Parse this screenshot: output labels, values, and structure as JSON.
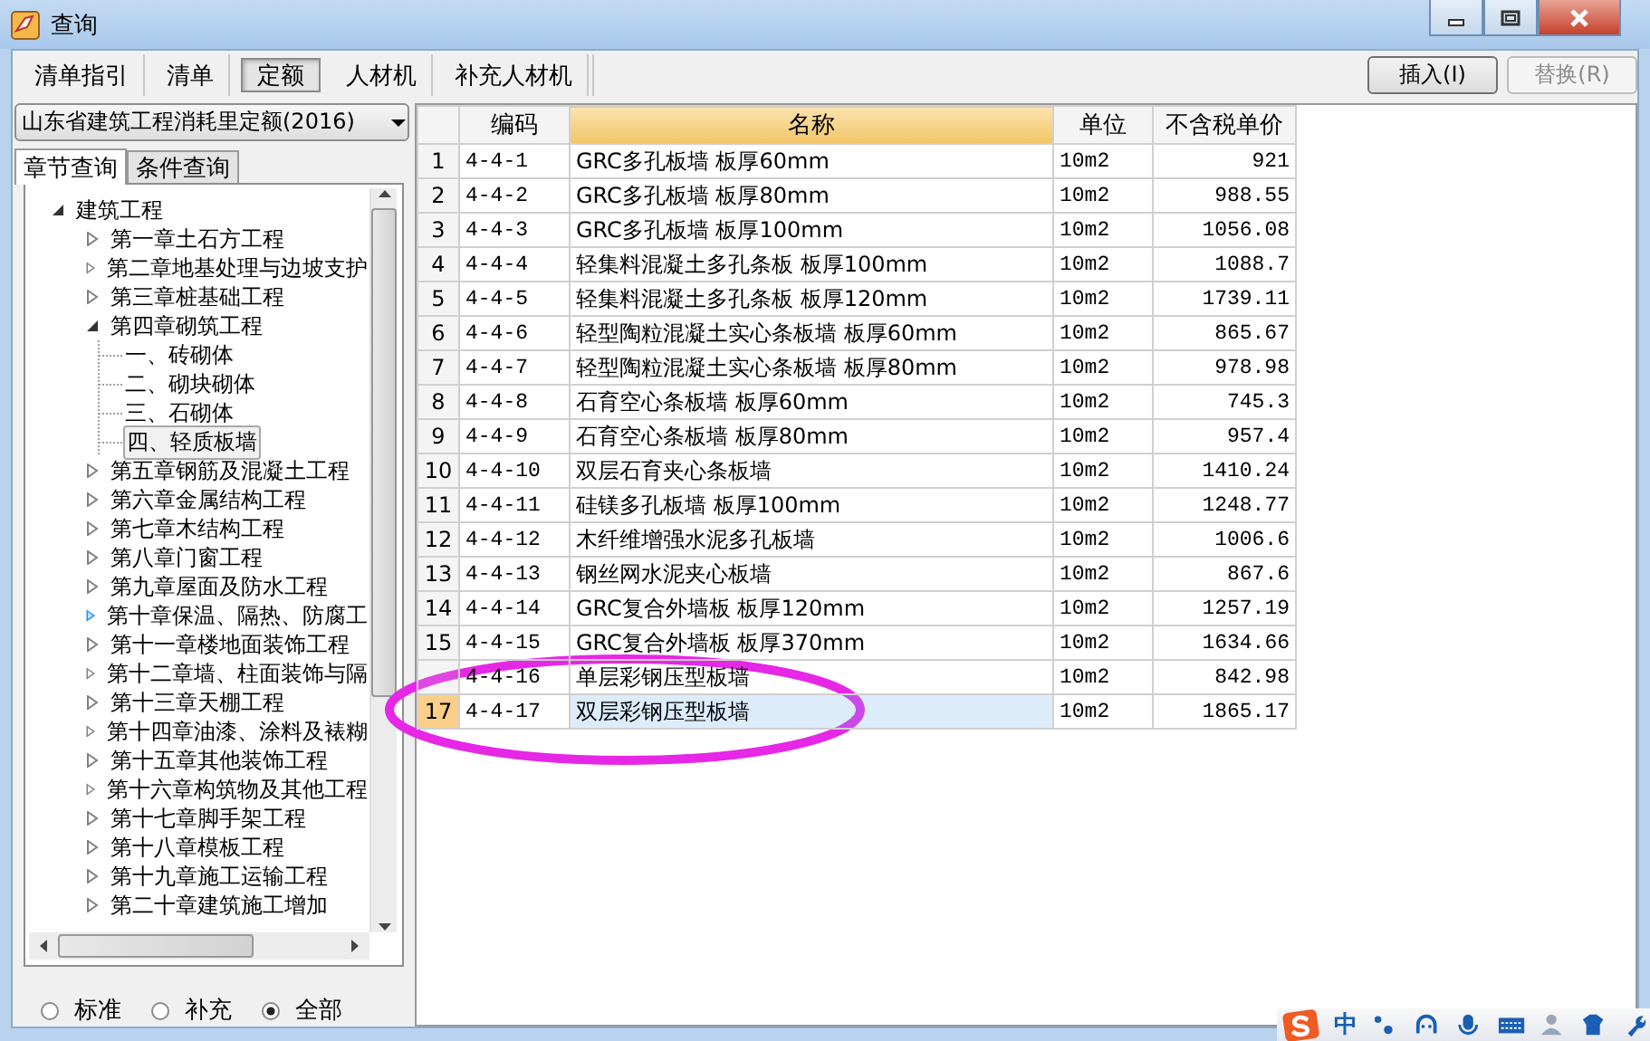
{
  "window": {
    "title": "查询"
  },
  "toolbar": {
    "tabs": [
      {
        "label": "清单指引",
        "selected": false
      },
      {
        "label": "清单",
        "selected": false
      },
      {
        "label": "定额",
        "selected": true
      },
      {
        "label": "人材机",
        "selected": false
      },
      {
        "label": "补充人材机",
        "selected": false
      }
    ],
    "buttons": [
      {
        "label": "插入(I)",
        "disabled": false
      },
      {
        "label": "替换(R)",
        "disabled": true
      }
    ]
  },
  "sidebar": {
    "dropdown": {
      "value": "山东省建筑工程消耗里定额(2016)"
    },
    "tabs": [
      {
        "label": "章节查询",
        "selected": true
      },
      {
        "label": "条件查询",
        "selected": false
      }
    ],
    "tree": [
      {
        "label": "建筑工程",
        "expanded": true,
        "selected": false,
        "children": [
          {
            "label": "第一章土石方工程",
            "expanded": false,
            "selected": false
          },
          {
            "label": "第二章地基处理与边坡支护",
            "expanded": false,
            "selected": false
          },
          {
            "label": "第三章桩基础工程",
            "expanded": false,
            "selected": false
          },
          {
            "label": "第四章砌筑工程",
            "expanded": true,
            "selected": false,
            "children": [
              {
                "label": "一、砖砌体",
                "selected": false
              },
              {
                "label": "二、砌块砌体",
                "selected": false
              },
              {
                "label": "三、石砌体",
                "selected": false
              },
              {
                "label": "四、轻质板墙",
                "selected": true
              }
            ]
          },
          {
            "label": "第五章钢筋及混凝土工程",
            "expanded": false,
            "selected": false
          },
          {
            "label": "第六章金属结构工程",
            "expanded": false,
            "selected": false
          },
          {
            "label": "第七章木结构工程",
            "expanded": false,
            "selected": false
          },
          {
            "label": "第八章门窗工程",
            "expanded": false,
            "selected": false
          },
          {
            "label": "第九章屋面及防水工程",
            "expanded": false,
            "selected": false
          },
          {
            "label": "第十章保温、隔热、防腐工",
            "expanded": false,
            "selected": false,
            "hot": true
          },
          {
            "label": "第十一章楼地面装饰工程",
            "expanded": false,
            "selected": false
          },
          {
            "label": "第十二章墙、柱面装饰与隔",
            "expanded": false,
            "selected": false
          },
          {
            "label": "第十三章天棚工程",
            "expanded": false,
            "selected": false
          },
          {
            "label": "第十四章油漆、涂料及裱糊",
            "expanded": false,
            "selected": false
          },
          {
            "label": "第十五章其他装饰工程",
            "expanded": false,
            "selected": false
          },
          {
            "label": "第十六章构筑物及其他工程",
            "expanded": false,
            "selected": false
          },
          {
            "label": "第十七章脚手架工程",
            "expanded": false,
            "selected": false
          },
          {
            "label": "第十八章模板工程",
            "expanded": false,
            "selected": false
          },
          {
            "label": "第十九章施工运输工程",
            "expanded": false,
            "selected": false
          },
          {
            "label": "第二十章建筑施工增加",
            "expanded": false,
            "selected": false
          }
        ]
      }
    ],
    "radios": [
      {
        "label": "标准",
        "selected": false
      },
      {
        "label": "补充",
        "selected": false
      },
      {
        "label": "全部",
        "selected": true
      }
    ]
  },
  "table": {
    "columns": [
      {
        "label": "编码",
        "sorted": false
      },
      {
        "label": "名称",
        "sorted": true
      },
      {
        "label": "单位",
        "sorted": false
      },
      {
        "label": "不含税单价",
        "sorted": false
      }
    ],
    "rows": [
      {
        "num": "1",
        "code": "4-4-1",
        "name": "GRC多孔板墙 板厚60mm",
        "unit": "10m2",
        "price": "921",
        "selected": false
      },
      {
        "num": "2",
        "code": "4-4-2",
        "name": "GRC多孔板墙 板厚80mm",
        "unit": "10m2",
        "price": "988.55",
        "selected": false
      },
      {
        "num": "3",
        "code": "4-4-3",
        "name": "GRC多孔板墙 板厚100mm",
        "unit": "10m2",
        "price": "1056.08",
        "selected": false
      },
      {
        "num": "4",
        "code": "4-4-4",
        "name": "轻集料混凝土多孔条板 板厚100mm",
        "unit": "10m2",
        "price": "1088.7",
        "selected": false
      },
      {
        "num": "5",
        "code": "4-4-5",
        "name": "轻集料混凝土多孔条板 板厚120mm",
        "unit": "10m2",
        "price": "1739.11",
        "selected": false
      },
      {
        "num": "6",
        "code": "4-4-6",
        "name": "轻型陶粒混凝土实心条板墙 板厚60mm",
        "unit": "10m2",
        "price": "865.67",
        "selected": false
      },
      {
        "num": "7",
        "code": "4-4-7",
        "name": "轻型陶粒混凝土实心条板墙 板厚80mm",
        "unit": "10m2",
        "price": "978.98",
        "selected": false
      },
      {
        "num": "8",
        "code": "4-4-8",
        "name": "石育空心条板墙 板厚60mm",
        "unit": "10m2",
        "price": "745.3",
        "selected": false
      },
      {
        "num": "9",
        "code": "4-4-9",
        "name": "石育空心条板墙 板厚80mm",
        "unit": "10m2",
        "price": "957.4",
        "selected": false
      },
      {
        "num": "10",
        "code": "4-4-10",
        "name": "双层石育夹心条板墙",
        "unit": "10m2",
        "price": "1410.24",
        "selected": false
      },
      {
        "num": "11",
        "code": "4-4-11",
        "name": "硅镁多孔板墙 板厚100mm",
        "unit": "10m2",
        "price": "1248.77",
        "selected": false
      },
      {
        "num": "12",
        "code": "4-4-12",
        "name": "木纤维增强水泥多孔板墙",
        "unit": "10m2",
        "price": "1006.6",
        "selected": false
      },
      {
        "num": "13",
        "code": "4-4-13",
        "name": "钢丝网水泥夹心板墙",
        "unit": "10m2",
        "price": "867.6",
        "selected": false
      },
      {
        "num": "14",
        "code": "4-4-14",
        "name": "GRC复合外墙板 板厚120mm",
        "unit": "10m2",
        "price": "1257.19",
        "selected": false
      },
      {
        "num": "15",
        "code": "4-4-15",
        "name": "GRC复合外墙板 板厚370mm",
        "unit": "10m2",
        "price": "1634.66",
        "selected": false
      },
      {
        "code": "4-4-16",
        "name": "单层彩钢压型板墙",
        "unit": "10m2",
        "price": "842.98",
        "selected": false
      },
      {
        "num": "17",
        "code": "4-4-17",
        "name": "双层彩钢压型板墙",
        "unit": "10m2",
        "price": "1865.17",
        "selected": true
      }
    ]
  },
  "annotation": {
    "kind": "ellipse"
  },
  "ime_bar": {
    "mode": "中"
  }
}
